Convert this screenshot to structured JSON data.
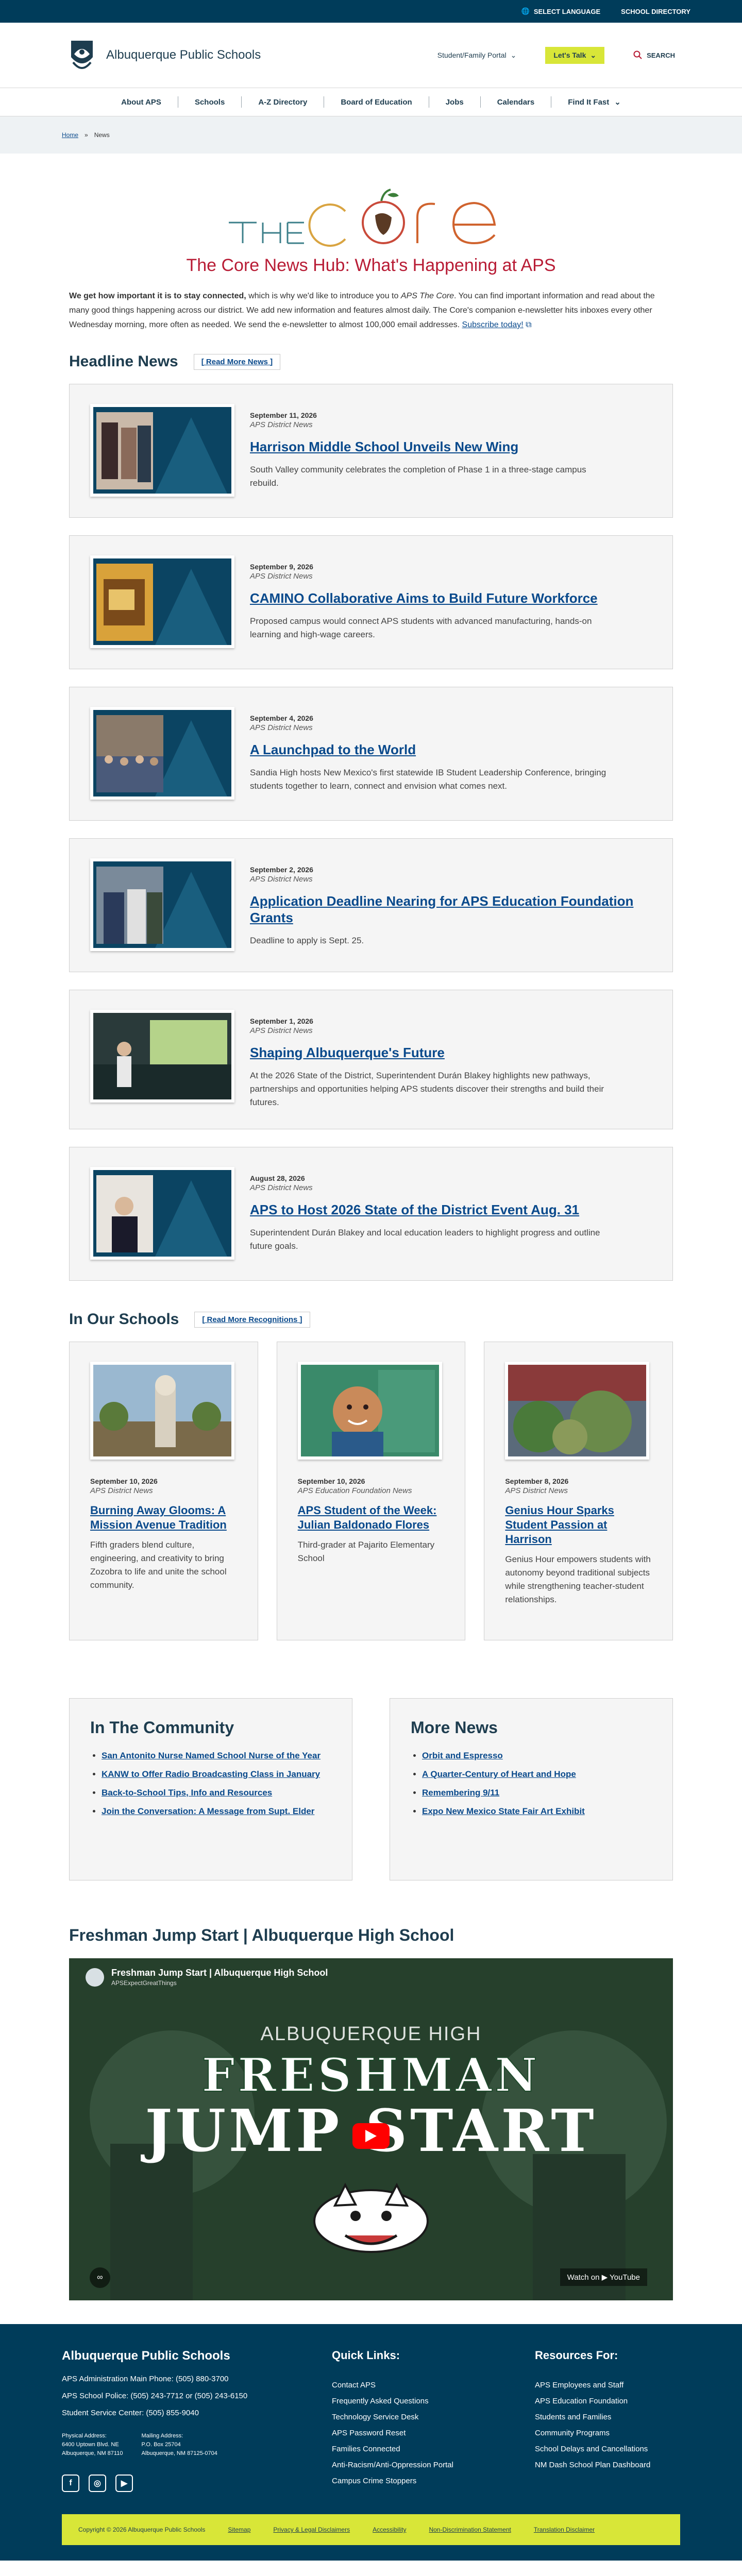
{
  "utility": {
    "select_language": "SELECT LANGUAGE",
    "school_directory": "SCHOOL DIRECTORY"
  },
  "header": {
    "brand": "Albuquerque Public Schools",
    "portal": "Student/Family Portal",
    "lets_talk": "Let's Talk",
    "search": "SEARCH"
  },
  "nav": {
    "items": [
      "About APS",
      "Schools",
      "A-Z Directory",
      "Board of Education",
      "Jobs",
      "Calendars",
      "Find It Fast"
    ]
  },
  "breadcrumb": {
    "home": "Home",
    "sep": "»",
    "current": "News"
  },
  "core": {
    "title": "The Core News Hub: What's Happening at APS",
    "intro_bold": "We get how important it is to stay connected,",
    "intro_1": " which is why we'd like to introduce you to ",
    "intro_italic": "APS The Core",
    "intro_2": ". You can find important information and read about the many good things happening across our district. We add new information and features almost daily. The Core's companion e-newsletter hits inboxes every other Wednesday morning, more often as needed. We send the e-newsletter to almost 100,000 email addresses. ",
    "subscribe": "Subscribe today!"
  },
  "headline": {
    "heading": "Headline News",
    "link": "[ Read More News ]",
    "items": [
      {
        "date": "September 11, 2026",
        "source": "APS District News",
        "title": "Harrison Middle School Unveils New Wing",
        "desc": "South Valley community celebrates the completion of Phase 1 in a three-stage campus rebuild."
      },
      {
        "date": "September 9, 2026",
        "source": "APS District News",
        "title": "CAMINO Collaborative Aims to Build Future Workforce",
        "desc": "Proposed campus would connect APS students with advanced manufacturing, hands-on learning and high-wage careers."
      },
      {
        "date": "September 4, 2026",
        "source": "APS District News",
        "title": "A Launchpad to the World",
        "desc": "Sandia High hosts New Mexico's first statewide IB Student Leadership Conference, bringing students together to learn, connect and envision what comes next."
      },
      {
        "date": "September 2, 2026",
        "source": "APS District News",
        "title": "Application Deadline Nearing for APS Education Foundation Grants",
        "desc": "Deadline to apply is Sept. 25."
      },
      {
        "date": "September 1, 2026",
        "source": "APS District News",
        "title": "Shaping Albuquerque's Future",
        "desc": "At the 2026 State of the District, Superintendent Durán Blakey highlights new pathways, partnerships and opportunities helping APS students discover their strengths and build their futures."
      },
      {
        "date": "August 28, 2026",
        "source": "APS District News",
        "title": "APS to Host 2026 State of the District Event Aug. 31",
        "desc": "Superintendent Durán Blakey and local education leaders to highlight progress and outline future goals."
      }
    ]
  },
  "schools": {
    "heading": "In Our Schools",
    "link": "[ Read More Recognitions ]",
    "items": [
      {
        "date": "September 10, 2026",
        "source": "APS District News",
        "title": "Burning Away Glooms: A Mission Avenue Tradition",
        "desc": "Fifth graders blend culture, engineering, and creativity to bring Zozobra to life and unite the school community."
      },
      {
        "date": "September 10, 2026",
        "source": "APS Education Foundation News",
        "title": "APS Student of the Week: Julian Baldonado Flores",
        "desc": "Third-grader at Pajarito Elementary School"
      },
      {
        "date": "September 8, 2026",
        "source": "APS District News",
        "title": "Genius Hour Sparks Student Passion at Harrison",
        "desc": "Genius Hour empowers students with autonomy beyond traditional subjects while strengthening teacher-student relationships."
      }
    ]
  },
  "community": {
    "heading": "In The Community",
    "items": [
      "San Antonito Nurse Named School Nurse of the Year",
      "KANW to Offer Radio Broadcasting Class in January",
      "Back-to-School Tips, Info and Resources",
      "Join the Conversation: A Message from Supt. Elder"
    ]
  },
  "more_news": {
    "heading": "More News",
    "items": [
      "Orbit and Espresso",
      "A Quarter-Century of Heart and Hope",
      "Remembering 9/11",
      "Expo New Mexico State Fair Art Exhibit"
    ]
  },
  "video": {
    "heading": "Freshman Jump Start | Albuquerque High School",
    "title": "Freshman Jump Start | Albuquerque High School",
    "channel": "APSExpectGreatThings",
    "overlay_1": "ALBUQUERQUE HIGH",
    "overlay_2": "FRESHMAN",
    "overlay_3": "JUMP START",
    "watch_on": "Watch on ▶ YouTube"
  },
  "footer": {
    "brand": "Albuquerque Public Schools",
    "lines": [
      "APS Administration Main Phone: (505) 880-3700",
      "APS School Police: (505) 243-7712 or (505) 243-6150",
      "Student Service Center: (505) 855-9040"
    ],
    "physical_label": "Physical Address:",
    "physical_1": "6400 Uptown Blvd. NE",
    "physical_2": "Albuquerque, NM 87110",
    "mailing_label": "Mailing Address:",
    "mailing_1": "P.O. Box 25704",
    "mailing_2": "Albuquerque, NM 87125-0704",
    "quick_label": "Quick Links:",
    "quick_links": [
      "Contact APS",
      "Frequently Asked Questions",
      "Technology Service Desk",
      "APS Password Reset",
      "Families Connected",
      "Anti-Racism/Anti-Oppression Portal",
      "Campus Crime Stoppers"
    ],
    "resources_label": "Resources For:",
    "resources": [
      "APS Employees and Staff",
      "APS Education Foundation",
      "Students and Families",
      "Community Programs",
      "School Delays and Cancellations",
      "NM Dash School Plan Dashboard"
    ],
    "copyright": "Copyright © 2026 Albuquerque Public Schools",
    "legal": [
      "Sitemap",
      "Privacy & Legal Disclaimers",
      "Accessibility",
      "Non-Discrimination Statement",
      "Translation Disclaimer"
    ]
  },
  "colors": {
    "navy": "#003c5a",
    "accent": "#d8e638",
    "title_red": "#b81c35",
    "link_blue": "#0a4a8c"
  }
}
